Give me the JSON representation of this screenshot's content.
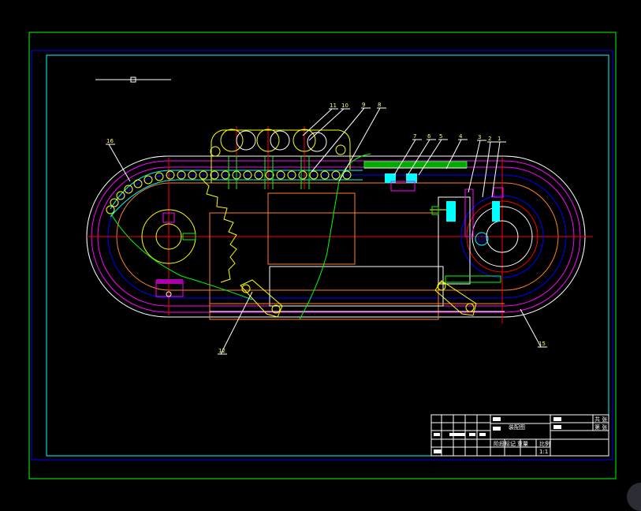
{
  "balloons": [
    "1",
    "2",
    "3",
    "4",
    "5",
    "6",
    "7",
    "8",
    "9",
    "10",
    "11",
    "12",
    "15",
    "16"
  ],
  "title_block": {
    "drawing_name": "装配图",
    "scale": "1:1",
    "sheets_label": "共 张",
    "sheet_label": "第 张",
    "stage_mark": "阶段标记",
    "weight": "重量",
    "scale_label": "比例",
    "rows": [
      "标记",
      "处数",
      "分区",
      "更改文件号",
      "签名",
      "年月日",
      "设计",
      "审核",
      "工艺",
      "批准"
    ]
  },
  "colors": {
    "background": "#000000",
    "frame_outer": "#00ff00",
    "frame_inner": "#00ffff",
    "border_blue": "#0000ff",
    "track_magenta": "#ff00ff",
    "chain_cyan": "#00ffff",
    "centerline_red": "#ff0000",
    "body_orange": "#ff7f27",
    "highlight_yellow": "#ffff00",
    "white_lines": "#ffffff"
  },
  "icons": [
    "scroll-button-icon"
  ]
}
